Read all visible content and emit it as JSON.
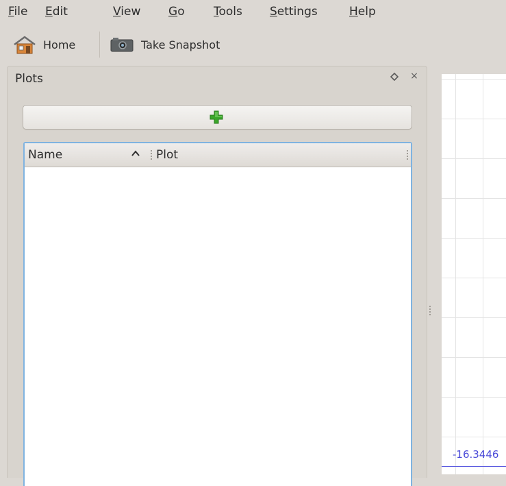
{
  "menubar": {
    "items": [
      {
        "label": "File",
        "accel": "F",
        "rest": "ile"
      },
      {
        "label": "Edit",
        "accel": "E",
        "rest": "dit"
      },
      {
        "label": "View",
        "accel": "V",
        "rest": "iew"
      },
      {
        "label": "Go",
        "accel": "G",
        "rest": "o"
      },
      {
        "label": "Tools",
        "accel": "T",
        "rest": "ools"
      },
      {
        "label": "Settings",
        "accel": "S",
        "rest": "ettings"
      },
      {
        "label": "Help",
        "accel": "H",
        "rest": "elp"
      }
    ]
  },
  "toolbar": {
    "home_label": "Home",
    "home_icon": "home-icon",
    "snapshot_label": "Take Snapshot",
    "snapshot_icon": "camera-icon"
  },
  "dock": {
    "title": "Plots",
    "float_icon": "float-icon",
    "close_icon": "close-icon",
    "close_glyph": "×",
    "add_icon": "plus-icon",
    "add_icon_color": "#3aa62a"
  },
  "list": {
    "columns": [
      "Name",
      "Plot"
    ],
    "sort_indicator": "ascending",
    "rows": []
  },
  "plot": {
    "axis_label": "-16.3446",
    "axis_color": "#4a4ad8"
  }
}
